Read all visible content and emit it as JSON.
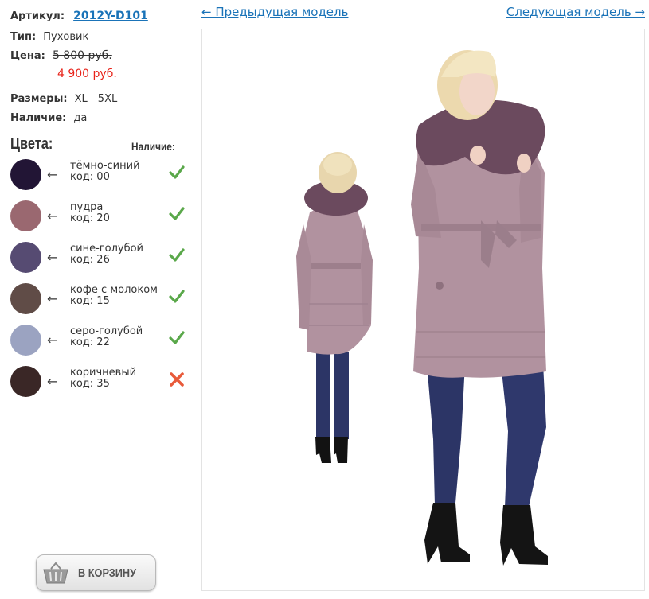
{
  "product": {
    "sku_label": "Артикул:",
    "sku": "2012Y-D101",
    "type_label": "Тип:",
    "type": "Пуховик",
    "price_label": "Цена:",
    "old_price": "5 800 руб.",
    "new_price": "4 900 руб.",
    "sizes_label": "Размеры:",
    "sizes": "XL—5XL",
    "stock_label": "Наличие:",
    "stock": "да"
  },
  "colors": {
    "heading": "Цвета:",
    "availability_heading": "Наличие:",
    "arrow": "←",
    "items": [
      {
        "name": "тёмно-синий",
        "code": "код: 00",
        "swatch": "#221535",
        "available": true
      },
      {
        "name": "пудра",
        "code": "код: 20",
        "swatch": "#9a6870",
        "available": true
      },
      {
        "name": "сине-голубой",
        "code": "код: 26",
        "swatch": "#564b72",
        "available": true
      },
      {
        "name": "кофе с молоком",
        "code": "код: 15",
        "swatch": "#604c47",
        "available": true
      },
      {
        "name": "серо-голубой",
        "code": "код: 22",
        "swatch": "#9ba3c1",
        "available": true
      },
      {
        "name": "коричневый",
        "code": "код: 35",
        "swatch": "#3a2726",
        "available": false
      }
    ]
  },
  "cart": {
    "label": "В КОРЗИНУ",
    "icon": "basket-icon"
  },
  "nav": {
    "prev": "← Предыдущая модель",
    "next": "Следующая модель →"
  },
  "photo": {
    "alt": "Пуховик 2012Y-D101",
    "coat_color": "#b1929f",
    "fur_color": "#6b4a5e",
    "jeans_color": "#2c3566"
  },
  "icons": {
    "available": "check-icon",
    "unavailable": "cross-icon"
  },
  "theme": {
    "link": "#1a73b8",
    "sale": "#e8231a",
    "check": "#5aa84a",
    "cross": "#e85a3a"
  }
}
